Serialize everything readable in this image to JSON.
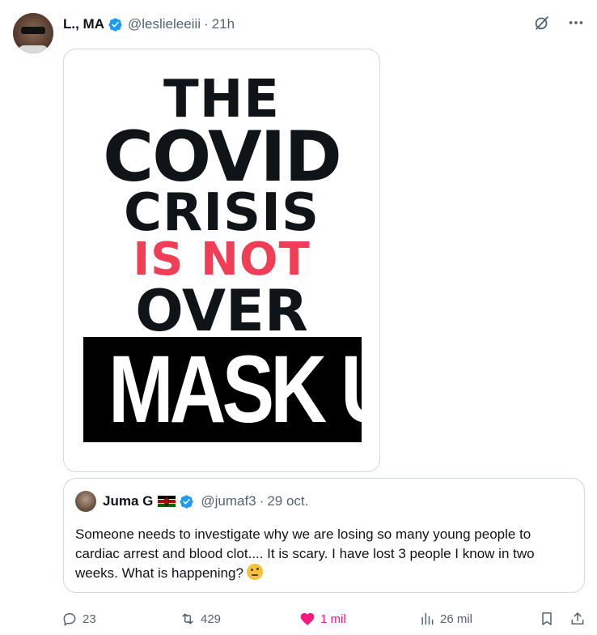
{
  "post": {
    "author_name": "L., MA",
    "author_handle": "@leslieleeiii",
    "separator": "·",
    "time": "21h"
  },
  "image": {
    "line1": "THE",
    "line2": "COVID",
    "line3": "CRISIS",
    "line4": "IS NOT",
    "line5": "OVER",
    "line6": "MASK UP",
    "accent_color": "#ef3e55"
  },
  "quoted": {
    "author_name": "Juma G",
    "author_handle": "@jumaf3",
    "separator": "·",
    "date": "29 oct.",
    "text": "Someone needs to investigate why we are losing so many young people to cardiac arrest and blood clot.... It is scary. I have lost 3 people I know in two weeks. What is happening?"
  },
  "actions": {
    "replies": "23",
    "reposts": "429",
    "likes": "1 mil",
    "views": "26 mil"
  },
  "colors": {
    "verified": "#1d9bf0",
    "like": "#f91880",
    "muted": "#536471"
  }
}
